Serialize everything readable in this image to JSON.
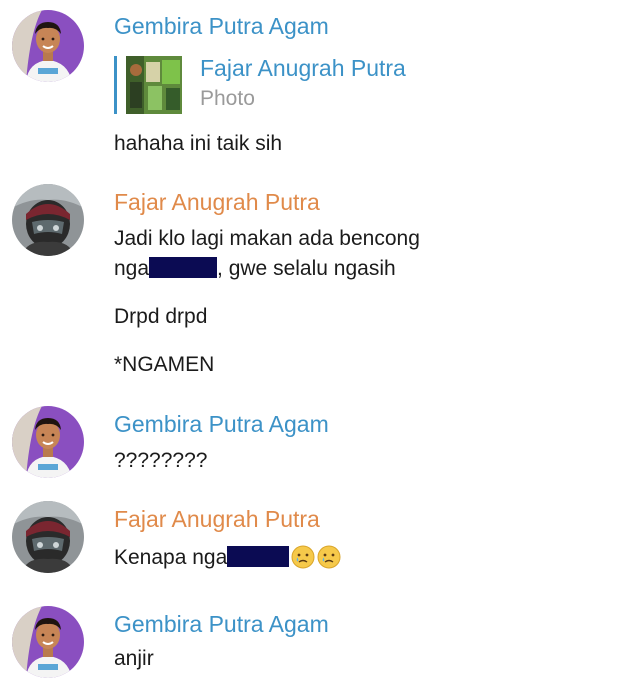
{
  "colors": {
    "sender_blue": "#3c92c7",
    "sender_orange": "#e08a4a",
    "text": "#1b1b1b",
    "subtext": "#9a9a9a",
    "redaction": "#0b0b53"
  },
  "messages": [
    {
      "sender": "Gembira Putra Agam",
      "sender_color": "blue",
      "avatar": "person-avatar",
      "reply": {
        "name": "Fajar Anugrah Putra",
        "subtitle": "Photo",
        "thumbnail": "photo-thumbnail"
      },
      "lines": [
        "hahaha ini taik sih"
      ]
    },
    {
      "sender": "Fajar Anugrah Putra",
      "sender_color": "orange",
      "avatar": "helmet-avatar",
      "lines": [
        "Jadi klo lagi makan ada bencong",
        "nga",
        ", gwe selalu ngasih",
        "Drpd drpd",
        "*NGAMEN"
      ]
    },
    {
      "sender": "Gembira Putra Agam",
      "sender_color": "blue",
      "avatar": "person-avatar",
      "lines": [
        "????????"
      ]
    },
    {
      "sender": "Fajar Anugrah Putra",
      "sender_color": "orange",
      "avatar": "helmet-avatar",
      "lines": [
        "Kenapa nga"
      ],
      "emojis": [
        "crying-face-emoji",
        "crying-face-emoji"
      ]
    },
    {
      "sender": "Gembira Putra Agam",
      "sender_color": "blue",
      "avatar": "person-avatar",
      "lines": [
        "anjir"
      ]
    }
  ]
}
